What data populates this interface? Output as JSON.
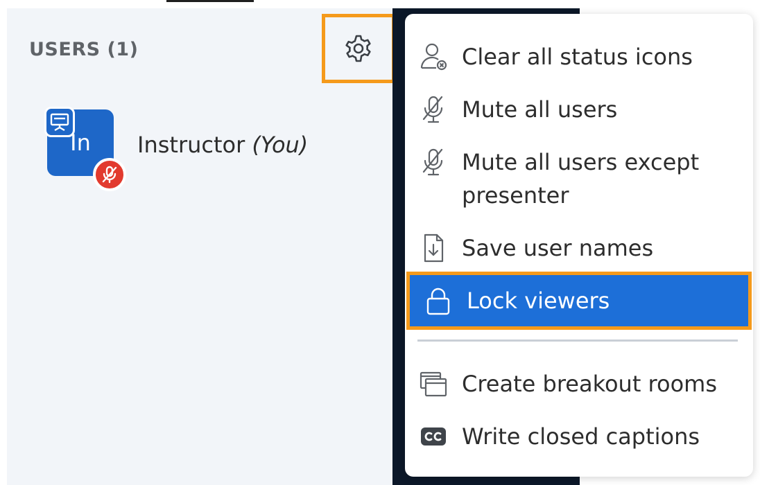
{
  "users_panel": {
    "header": "USERS (1)",
    "user": {
      "initials": "In",
      "name": "Instructor",
      "you_label": "(You)"
    }
  },
  "menu": {
    "items": [
      {
        "label": "Clear all status icons",
        "icon": "user-clear-icon"
      },
      {
        "label": "Mute all users",
        "icon": "mic-muted-icon"
      },
      {
        "label": "Mute all users except presenter",
        "icon": "mic-muted-icon"
      },
      {
        "label": "Save user names",
        "icon": "file-download-icon"
      },
      {
        "label": "Lock viewers",
        "icon": "lock-icon",
        "highlighted": true
      },
      {
        "label": "Create breakout rooms",
        "icon": "windows-icon"
      },
      {
        "label": "Write closed captions",
        "icon": "cc-icon"
      }
    ]
  },
  "colors": {
    "accent_blue": "#1d6fd8",
    "highlight_orange": "#f59a1b",
    "avatar_blue": "#1e67c8",
    "mute_red": "#e23a2e",
    "panel_bg": "#f2f5f9",
    "dark_strip": "#0c1829"
  }
}
